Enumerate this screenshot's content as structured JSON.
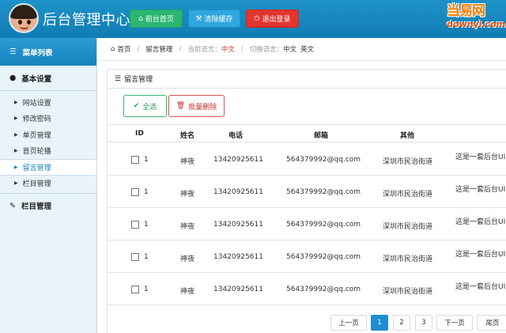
{
  "header": {
    "title": "后台管理中心",
    "buttons": [
      {
        "label": "前台首页",
        "icon": "home-icon",
        "color": "#2bb673"
      },
      {
        "label": "清除缓存",
        "icon": "wrench-icon",
        "color": "#2fa6e0"
      },
      {
        "label": "退出登录",
        "icon": "power-icon",
        "color": "#e2352e"
      }
    ],
    "brand_logo": {
      "cn": "当易网",
      "en": "downyi.com"
    }
  },
  "sidebar": {
    "title": "菜单列表",
    "groups": [
      {
        "label": "基本设置",
        "items": [
          "网站设置",
          "修改密码",
          "单页管理",
          "首页轮播",
          "留言管理",
          "栏目管理"
        ],
        "active_index": 4
      },
      {
        "label": "栏目管理",
        "items": []
      }
    ]
  },
  "breadcrumb": {
    "home": "首页",
    "section": "留言管理",
    "current_lang_label": "当前语言：",
    "current_lang_value": "中文",
    "switch_lang_label": "切换语言：",
    "langs": [
      "中文",
      "英文"
    ]
  },
  "panel": {
    "title": "留言管理",
    "select_all": "全选",
    "bulk_delete": "批量删除",
    "columns": [
      "ID",
      "姓名",
      "电话",
      "邮箱",
      "其他"
    ],
    "rows": [
      {
        "id": "1",
        "name": "神夜",
        "phone": "13420925611",
        "email": "564379992@qq.com",
        "other": "深圳市民治街道",
        "content": "这是一套后台UI"
      },
      {
        "id": "1",
        "name": "神夜",
        "phone": "13420925611",
        "email": "564379992@qq.com",
        "other": "深圳市民治街道",
        "content": "这是一套后台UI"
      },
      {
        "id": "1",
        "name": "神夜",
        "phone": "13420925611",
        "email": "564379992@qq.com",
        "other": "深圳市民治街道",
        "content": "这是一套后台UI"
      },
      {
        "id": "1",
        "name": "神夜",
        "phone": "13420925611",
        "email": "564379992@qq.com",
        "other": "深圳市民治街道",
        "content": "这是一套后台UI"
      },
      {
        "id": "1",
        "name": "神夜",
        "phone": "13420925611",
        "email": "564379992@qq.com",
        "other": "深圳市民治街道",
        "content": "这是一套后台UI"
      }
    ]
  },
  "pagination": {
    "prev": "上一页",
    "pages": [
      "1",
      "2",
      "3"
    ],
    "active_page": "1",
    "next": "下一页",
    "last": "尾页"
  },
  "colors": {
    "accent": "#1582c2",
    "header_bg": "#1e93c9",
    "sidebar_bg": "#e9f3fa",
    "success": "#2bb673",
    "danger": "#e2352e"
  }
}
